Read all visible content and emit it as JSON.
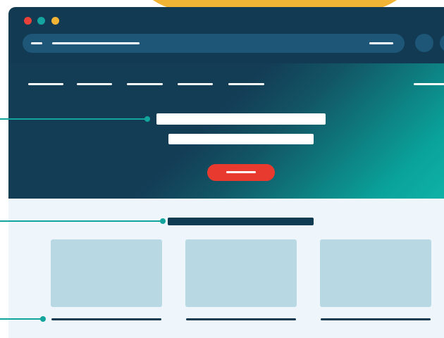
{
  "colors": {
    "accent_orange": "#f2b434",
    "window_dark": "#123a52",
    "url_bar": "#1d5677",
    "hero_teal": "#10b5aa",
    "cta_red": "#e83a2e",
    "content_bg": "#eff6fb",
    "card_fill": "#b8d9e3",
    "callout_teal": "#12a59d",
    "traffic_lights": [
      "#e8413a",
      "#15a5a0",
      "#f2b434"
    ]
  },
  "browser": {
    "traffic_lights": [
      "close",
      "minimize",
      "maximize"
    ],
    "toolbar_buttons": [
      "toolbar-button",
      "toolbar-button"
    ]
  },
  "hero": {
    "nav_links": [
      "nav-link",
      "nav-link",
      "nav-link",
      "nav-link",
      "nav-link"
    ]
  },
  "content": {
    "cards": [
      "card",
      "card",
      "card"
    ]
  },
  "callouts": [
    "callout-hero-headline",
    "callout-section-title",
    "callout-card-caption"
  ]
}
